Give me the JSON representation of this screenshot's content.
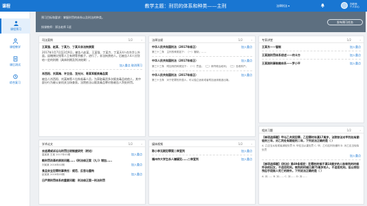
{
  "app": {
    "logo": "课程",
    "title": "教学主题：刑罚的体系和种类——主刑",
    "selector": "法律刑法 ▾",
    "user_line1": "刘老师",
    "user_line2": "个人中心"
  },
  "sidebar": {
    "items": [
      {
        "label": "课程预习"
      },
      {
        "label": "课程教学"
      },
      {
        "label": "课后测试"
      },
      {
        "label": "综合复习"
      }
    ]
  },
  "banner": {
    "line1": "预习目标和要求：掌握刑罚的体系以及刑法的种类。",
    "line2": "授课教师：郑法老师 1班",
    "button": "发布预习任务"
  },
  "panels": {
    "cases": {
      "title": "司法案例",
      "page": "1/2",
      "text1a": "王某强、赵某、丁某力、丁某天非法拘禁案",
      "text1b": "2017年1月7日至2月9日，被告人赵某、王某强、丁某力、丁某天4人在东华上外面，因赌博欠钱等人王有明等余额子，进行了，非法拘禁他人。后被告人4人分别给一定的刑期（具体刑期及判决结果）。",
      "text2a": "肖西阳、刘某梅、许立佳、龙光兴、寿某军贩卖毒品案",
      "text2b": "被告人肖西阳、刘某梅等人均系吸毒人员，为获取毒资多次贩卖毒品给他人，其中部分行为被公安机关当场查获。法院依法以贩卖毒品罪对各被告人判处刑罚。",
      "action_add": "加入重点",
      "action_cancel": "取消预习"
    },
    "laws": {
      "title": "法律法规",
      "page": "1/2",
      "h1": "中华人民共和国刑法（2017年修正）",
      "b1": "第三十二条　主刑的种类如下：（一）管制；……",
      "h2": "中华人民共和国刑法（2017年修正）",
      "b2": "第三十三条　附加刑的种类如下：（一）罚金；（二）剥夺政治权利；（三）没收财产。",
      "h3": "中华人民共和国刑法（2017年修正）",
      "b3": "第三十五条　对于犯罪的外国人，可以独立适用或者附加适用驱逐出境。",
      "action_add": "加入重点",
      "action_cancel": "取消预习"
    },
    "expert": {
      "title": "专家讲堂",
      "page": "1/2",
      "i1": "王某东——管制",
      "i2": "王某刚刑罚体系综述——何卡方",
      "i3": "王某刚刑事制裁体系——罗小平",
      "action_add": "加入重点",
      "action_cancel": "取消预习"
    },
    "papers": {
      "title": "学术论文",
      "page": "1/2",
      "p1t": "去追溯或诉讼与刑罚比较制度研究（附论）",
      "p1s": "高某某 王某 2017年03期",
      "p2t": "教刑罚改革的原则问题……《刑法修正案（九）》增加……",
      "p2s": "刘某某 2016年02期",
      "p3t": "食品安全犯罪刑事责任：规范、反思与重构",
      "p3s": "赵某某 2016年05期",
      "p4t": "日严肃刑罚体系的重要问题：刑法修正案一刑法刑罚",
      "action_add": "加入重点",
      "action_cancel": "取消预习"
    },
    "videos": {
      "title": "媒体视频",
      "page": "1/2",
      "v1": "陈小李无期犯罪案二审宣判",
      "v2": "福州市大学生杀人嫌疑犯……二审宣判",
      "action_add": "加入重点",
      "action_cancel": "取消预习"
    },
    "questions": {
      "title": "相关习题",
      "page": "1/2",
      "q1": "【单项选择题】甲与乙共同犯罪，乙犯罪时年满17周岁，法院依法对甲判处有期徒刑三年，对乙判处有期徒刑二年，下列说法正确的是（ ）",
      "q1o": "A. 乙应当从轻或者减轻处罚  B. 甲应当从重处罚  C. 甲、乙均应判处缓刑  D. 对乙应当免除处罚",
      "q2": "【单项选择题】《刑法》第49条规定：犯罪的时候不满18周岁的人和审判的时候怀孕的妇女，不适用死刑。审判的时候已满75周岁的人，不适用死刑，但以特别残忍手段致人死亡的除外。下列说法正确的是（ ）",
      "q2o": "A. 对……  B. 对……  C. 对……  D. 对……",
      "action_add": "加入重点",
      "action_cancel": "取消预习"
    }
  },
  "colors": {
    "primary": "#1976d2",
    "highlight": "#d32f2f",
    "banner": "#5d6f80"
  }
}
